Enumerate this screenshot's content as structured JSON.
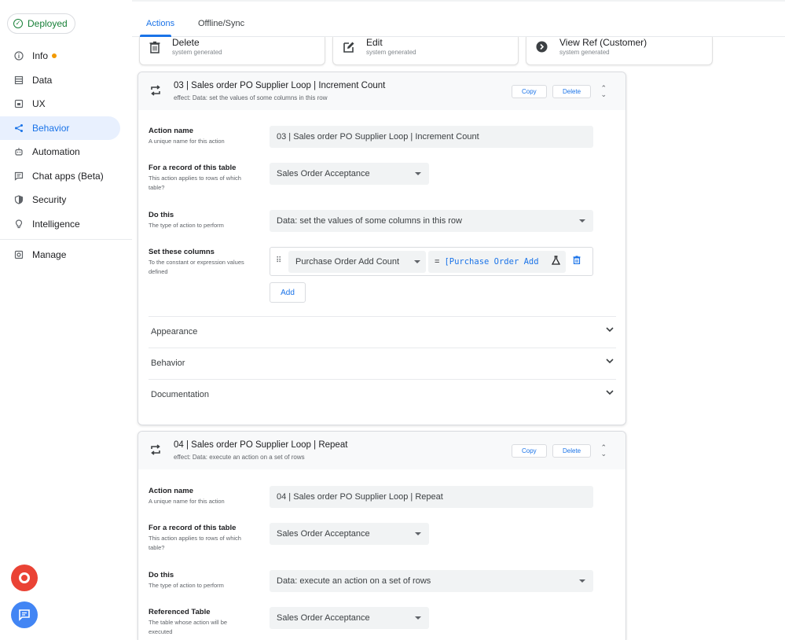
{
  "sidebar": {
    "status": "Deployed",
    "items": [
      {
        "label": "Info",
        "icon": "info-icon"
      },
      {
        "label": "Data",
        "icon": "data-icon"
      },
      {
        "label": "UX",
        "icon": "ux-icon"
      },
      {
        "label": "Behavior",
        "icon": "behavior-icon"
      },
      {
        "label": "Automation",
        "icon": "automation-icon"
      },
      {
        "label": "Chat apps (Beta)",
        "icon": "chat-icon"
      },
      {
        "label": "Security",
        "icon": "shield-icon"
      },
      {
        "label": "Intelligence",
        "icon": "lightbulb-icon"
      },
      {
        "label": "Manage",
        "icon": "manage-icon"
      }
    ],
    "active_item": "Behavior",
    "info_dot_color": "#f29900"
  },
  "tabs": [
    {
      "label": "Actions",
      "active": true
    },
    {
      "label": "Offline/Sync",
      "active": false
    }
  ],
  "summary_cards": [
    {
      "title": "Delete",
      "subtitle": "system generated",
      "icon": "trash-icon"
    },
    {
      "title": "Edit",
      "subtitle": "system generated",
      "icon": "edit-icon"
    },
    {
      "title": "View Ref (Customer)",
      "subtitle": "system generated",
      "icon": "arrow-circle-icon"
    }
  ],
  "panels": [
    {
      "title": "03 | Sales order PO Supplier Loop | Increment Count",
      "effect": "effect: Data: set the values of some columns in this row",
      "copy_label": "Copy",
      "delete_label": "Delete",
      "fields": {
        "action_name": {
          "label": "Action name",
          "hint": "A unique name for this action",
          "value": "03 | Sales order PO Supplier Loop | Increment Count"
        },
        "table": {
          "label": "For a record of this table",
          "hint": "This action applies to rows of which table?",
          "value": "Sales Order Acceptance"
        },
        "do_this": {
          "label": "Do this",
          "hint": "The type of action to perform",
          "value": "Data: set the values of some columns in this row"
        },
        "set_columns": {
          "label": "Set these columns",
          "hint": "To the constant or expression values defined",
          "column": "Purchase Order Add Count",
          "eq": "=",
          "expression": "[Purchase Order Add"
        },
        "add_label": "Add"
      },
      "sections": [
        "Appearance",
        "Behavior",
        "Documentation"
      ]
    },
    {
      "title": "04 | Sales order PO Supplier Loop | Repeat",
      "effect": "effect: Data: execute an action on a set of rows",
      "copy_label": "Copy",
      "delete_label": "Delete",
      "fields": {
        "action_name": {
          "label": "Action name",
          "hint": "A unique name for this action",
          "value": "04 | Sales order PO Supplier Loop | Repeat"
        },
        "table": {
          "label": "For a record of this table",
          "hint": "This action applies to rows of which table?",
          "value": "Sales Order Acceptance"
        },
        "do_this": {
          "label": "Do this",
          "hint": "The type of action to perform",
          "value": "Data: execute an action on a set of rows"
        },
        "ref_table": {
          "label": "Referenced Table",
          "hint": "The table whose action will be executed",
          "value": "Sales Order Acceptance"
        }
      }
    }
  ]
}
